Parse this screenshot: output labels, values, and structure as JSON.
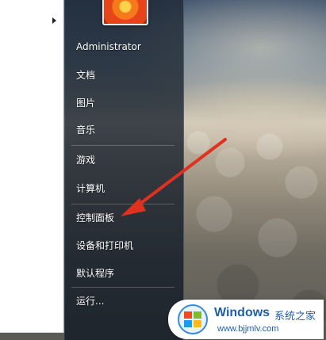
{
  "start_menu": {
    "user_name": "Administrator",
    "items": [
      {
        "label": "文档"
      },
      {
        "label": "图片"
      },
      {
        "label": "音乐"
      },
      {
        "label": "游戏"
      },
      {
        "label": "计算机"
      },
      {
        "label": "控制面板"
      },
      {
        "label": "设备和打印机"
      },
      {
        "label": "默认程序"
      },
      {
        "label": "运行..."
      }
    ]
  },
  "annotation": {
    "color": "#e03020"
  },
  "watermark": {
    "brand": "Windows",
    "subtitle": "系统之家",
    "url": "www.bjjmlv.com"
  }
}
